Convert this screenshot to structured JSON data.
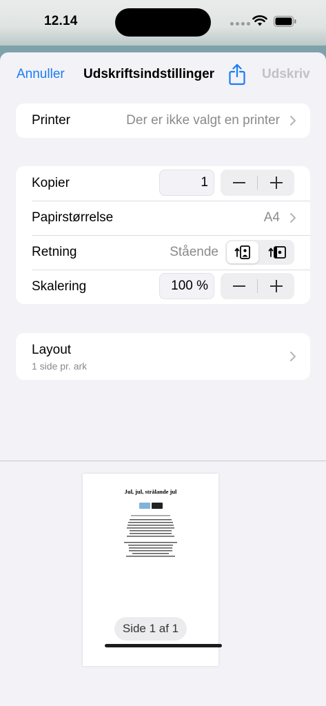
{
  "status_bar": {
    "time": "12.14"
  },
  "navbar": {
    "cancel_label": "Annuller",
    "title": "Udskriftsindstillinger",
    "print_label": "Udskriv"
  },
  "printer_row": {
    "label": "Printer",
    "value": "Der er ikke valgt en printer"
  },
  "settings": {
    "copies": {
      "label": "Kopier",
      "value": "1"
    },
    "paper_size": {
      "label": "Papirstørrelse",
      "value": "A4"
    },
    "orientation": {
      "label": "Retning",
      "value": "Stående",
      "selected": "portrait"
    },
    "scaling": {
      "label": "Skalering",
      "value": "100 %"
    }
  },
  "layout_row": {
    "label": "Layout",
    "subtitle": "1 side pr. ark"
  },
  "preview": {
    "document_title": "Jul, jul, strålande jul",
    "page_indicator": "Side 1 af 1"
  },
  "colors": {
    "accent": "#1a7cf3",
    "disabled": "#c1c1c6",
    "secondary_text": "#8a8a8e"
  }
}
